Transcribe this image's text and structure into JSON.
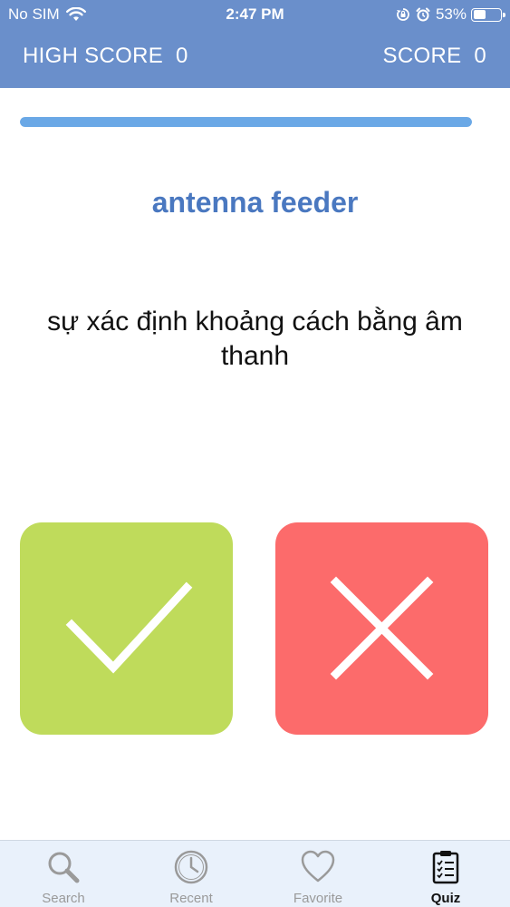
{
  "status_bar": {
    "carrier": "No SIM",
    "time": "2:47 PM",
    "battery_text": "53%",
    "battery_level": 0.53
  },
  "header": {
    "high_score_label": "HIGH SCORE",
    "high_score_value": "0",
    "score_label": "SCORE",
    "score_value": "0"
  },
  "quiz": {
    "progress": 1.0,
    "word": "antenna feeder",
    "meaning": "sự xác định khoảng cách bằng âm thanh",
    "true_button_icon": "checkmark-icon",
    "false_button_icon": "x-icon",
    "colors": {
      "true": "#bfdb5b",
      "false": "#fc6b6b",
      "word": "#4a78c0",
      "header": "#6a8fcb"
    }
  },
  "tabbar": {
    "items": [
      {
        "label": "Search",
        "icon": "search-icon",
        "active": false
      },
      {
        "label": "Recent",
        "icon": "clock-icon",
        "active": false
      },
      {
        "label": "Favorite",
        "icon": "heart-icon",
        "active": false
      },
      {
        "label": "Quiz",
        "icon": "clipboard-icon",
        "active": true
      }
    ]
  }
}
